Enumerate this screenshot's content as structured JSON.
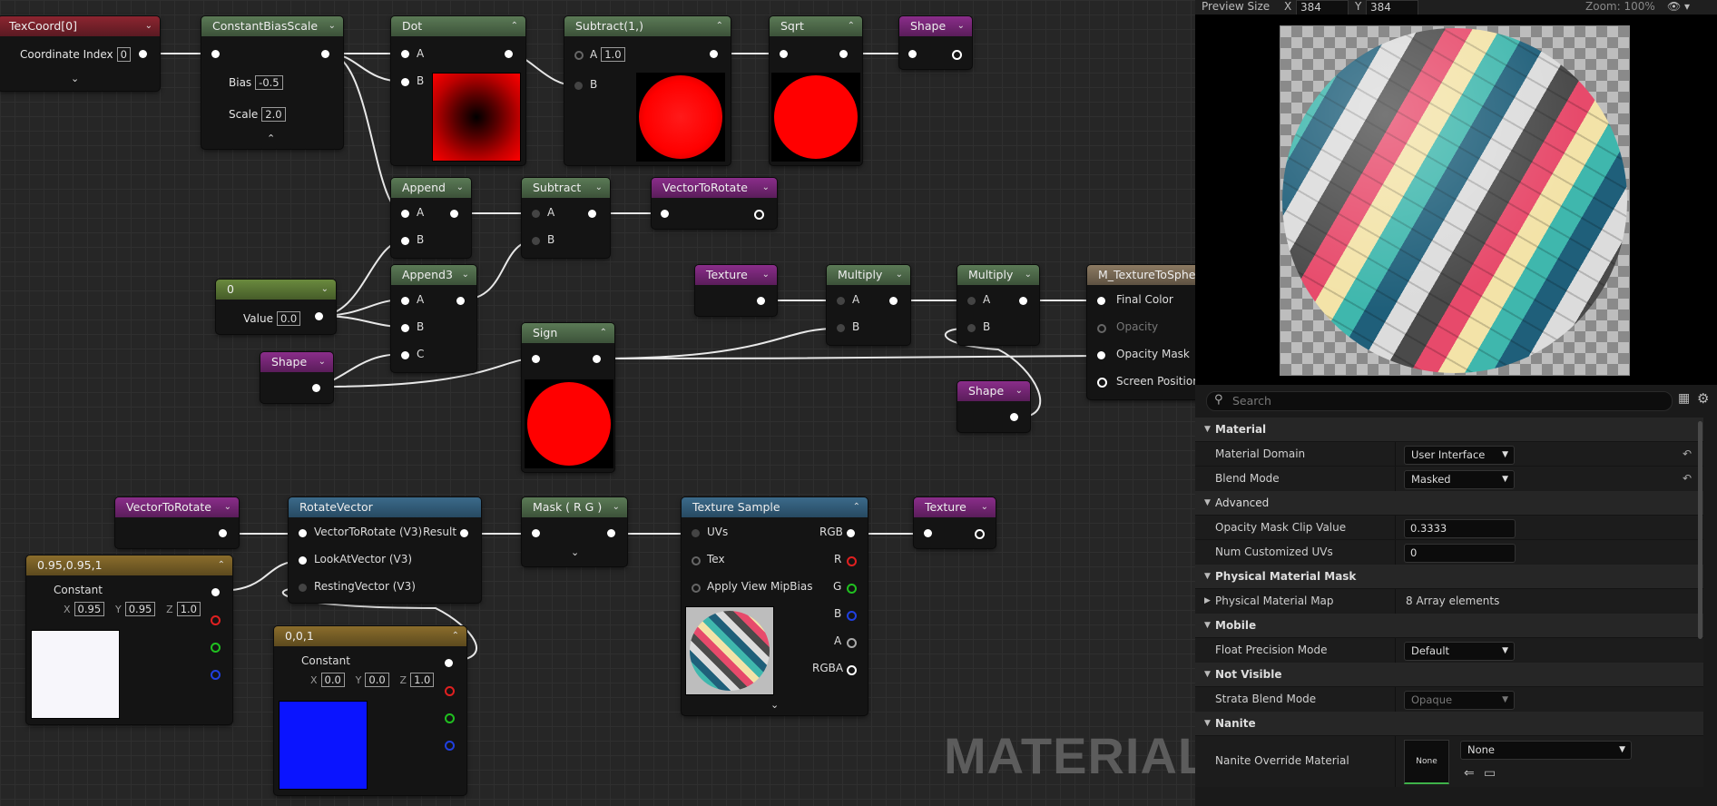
{
  "graph": {
    "watermark": "MATERIAL",
    "nodes": {
      "texcoord": {
        "title": "TexCoord[0]",
        "coord_label": "Coordinate Index",
        "coord_value": "0"
      },
      "cbs": {
        "title": "ConstantBiasScale",
        "bias_label": "Bias",
        "bias_value": "-0.5",
        "scale_label": "Scale",
        "scale_value": "2.0"
      },
      "dot": {
        "title": "Dot",
        "in_a": "A",
        "in_b": "B"
      },
      "subtract1": {
        "title": "Subtract(1,)",
        "in_a": "A",
        "a_value": "1.0",
        "in_b": "B"
      },
      "sqrt": {
        "title": "Sqrt"
      },
      "shape_top": {
        "title": "Shape"
      },
      "append": {
        "title": "Append",
        "in_a": "A",
        "in_b": "B"
      },
      "subtract": {
        "title": "Subtract",
        "in_a": "A",
        "in_b": "B"
      },
      "vtr_top": {
        "title": "VectorToRotate"
      },
      "zero": {
        "title": "0",
        "value_label": "Value",
        "value": "0.0"
      },
      "append3": {
        "title": "Append3",
        "in_a": "A",
        "in_b": "B",
        "in_c": "C"
      },
      "shape_left": {
        "title": "Shape"
      },
      "sign": {
        "title": "Sign"
      },
      "texture_mid": {
        "title": "Texture"
      },
      "multiply1": {
        "title": "Multiply",
        "in_a": "A",
        "in_b": "B"
      },
      "multiply2": {
        "title": "Multiply",
        "in_a": "A",
        "in_b": "B"
      },
      "result": {
        "title": "M_TextureToSphe",
        "final_color": "Final Color",
        "opacity": "Opacity",
        "opacity_mask": "Opacity Mask",
        "screen_position": "Screen Position"
      },
      "shape_right": {
        "title": "Shape"
      },
      "vtr_bottom": {
        "title": "VectorToRotate"
      },
      "rotate_vector": {
        "title": "RotateVector",
        "in1": "VectorToRotate (V3)",
        "out": "Result",
        "in2": "LookAtVector (V3)",
        "in3": "RestingVector (V3)"
      },
      "mask": {
        "title": "Mask ( R G )"
      },
      "texture_sample": {
        "title": "Texture Sample",
        "uvs": "UVs",
        "tex": "Tex",
        "mip": "Apply View MipBias",
        "rgb": "RGB",
        "r": "R",
        "g": "G",
        "b": "B",
        "a": "A",
        "rgba": "RGBA"
      },
      "texture_out": {
        "title": "Texture"
      },
      "const_a": {
        "title": "0.95,0.95,1",
        "label": "Constant",
        "x_label": "X",
        "x": "0.95",
        "y_label": "Y",
        "y": "0.95",
        "z_label": "Z",
        "z": "1.0",
        "swatch": "#f7f6fb"
      },
      "const_b": {
        "title": "0,0,1",
        "label": "Constant",
        "x_label": "X",
        "x": "0.0",
        "y_label": "Y",
        "y": "0.0",
        "z_label": "Z",
        "z": "1.0",
        "swatch": "#0a14ff"
      }
    }
  },
  "preview": {
    "size_label": "Preview Size",
    "x_label": "X",
    "x_value": "384",
    "y_label": "Y",
    "y_value": "384",
    "zoom": "Zoom: 100%"
  },
  "details": {
    "search_placeholder": "Search",
    "categories": {
      "material": "Material",
      "advanced": "Advanced",
      "physical_mask": "Physical Material Mask",
      "mobile": "Mobile",
      "not_visible": "Not Visible",
      "nanite": "Nanite"
    },
    "props": {
      "material_domain": {
        "label": "Material Domain",
        "value": "User Interface"
      },
      "blend_mode": {
        "label": "Blend Mode",
        "value": "Masked"
      },
      "opacity_clip": {
        "label": "Opacity Mask Clip Value",
        "value": "0.3333"
      },
      "num_uvs": {
        "label": "Num Customized UVs",
        "value": "0"
      },
      "phys_map": {
        "label": "Physical Material Map",
        "value": "8 Array elements"
      },
      "float_precision": {
        "label": "Float Precision Mode",
        "value": "Default"
      },
      "strata_blend": {
        "label": "Strata Blend Mode",
        "value": "Opaque"
      },
      "nanite_override": {
        "label": "Nanite Override Material",
        "thumb": "None",
        "value": "None"
      }
    }
  }
}
